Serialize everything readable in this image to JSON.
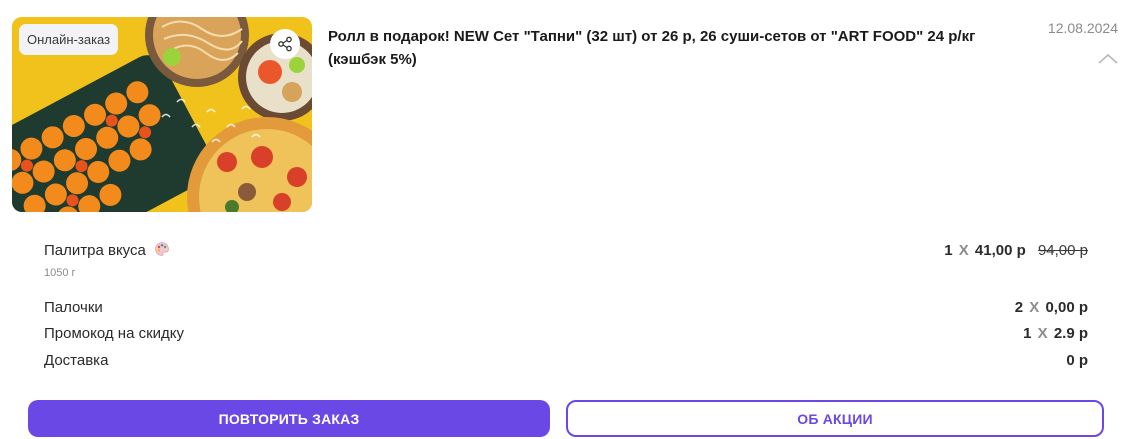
{
  "offer": {
    "badge": "Онлайн-заказ",
    "title": "Ролл в подарок! NEW Сет \"Тапни\" (32 шт) от 26 р, 26 суши-сетов от \"ART FOOD\" 24 р/кг (кэшбэк 5%)",
    "date": "12.08.2024",
    "icons": {
      "share": "share-icon",
      "collapse": "chevron-up-icon",
      "palette": "palette-icon"
    }
  },
  "items": [
    {
      "name": "Палитра вкуса",
      "qty": "1",
      "x": "X",
      "price": "41,00 р",
      "old_price": "94,00 р",
      "weight": "1050 г"
    },
    {
      "name": "Палочки",
      "qty": "2",
      "x": "X",
      "price": "0,00 р"
    },
    {
      "name": "Промокод на скидку",
      "qty": "1",
      "x": "X",
      "price": "2.9 р"
    },
    {
      "name": "Доставка",
      "price": "0 р"
    }
  ],
  "actions": {
    "repeat_label": "ПОВТОРИТЬ ЗАКАЗ",
    "about_label": "ОБ АКЦИИ"
  },
  "colors": {
    "accent": "#6a48e6",
    "image_bg": "#f2c21c",
    "muted": "#8a8a8a"
  }
}
